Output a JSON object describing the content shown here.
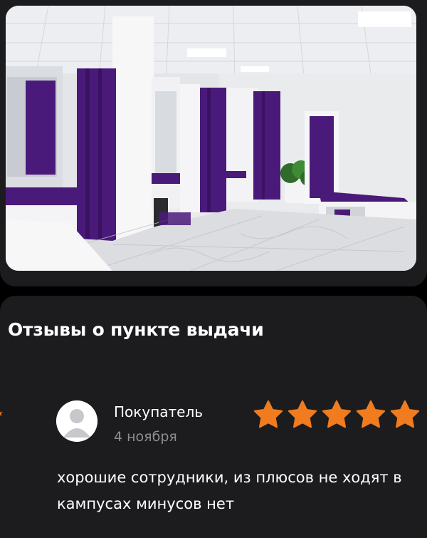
{
  "photo": {
    "alt_icon": "photo-image"
  },
  "reviews": {
    "title": "Отзывы о пункте выдачи",
    "items": [
      {
        "author": "Покупатель",
        "date": "4 ноября",
        "rating": 5,
        "rating_max": 5,
        "text": "хорошие сотрудники, из плюсов не ходят в кампусах минусов нет",
        "avatar_icon": "user-placeholder-icon",
        "star_icon": "star-icon"
      }
    ]
  },
  "colors": {
    "background": "#000000",
    "card": "#1c1c1e",
    "text": "#ffffff",
    "secondary_text": "#8e8e93",
    "star": "#f07c1f",
    "curtain": "#4a1a7a"
  }
}
